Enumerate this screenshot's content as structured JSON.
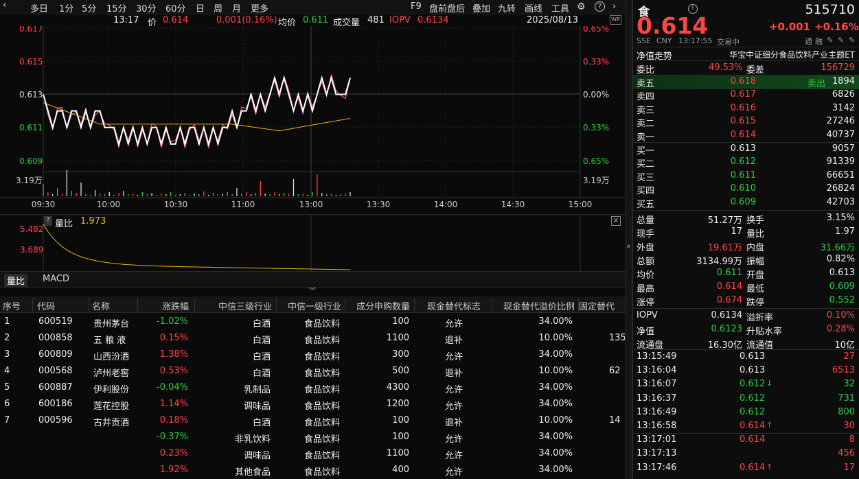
{
  "toolbar": {
    "periods": [
      "多日",
      "1分",
      "5分",
      "15分",
      "30分",
      "60分",
      "日",
      "周",
      "月",
      "更多"
    ],
    "actions": [
      "F9",
      "盘前盘后",
      "叠加",
      "九转",
      "画线",
      "工具"
    ]
  },
  "info": {
    "time": "13:17",
    "price_label": "价",
    "price": "0.614",
    "change": "0.001(0.16%)",
    "avg_label": "均价",
    "avg": "0.611",
    "vol_label": "成交量",
    "vol": "481",
    "iopv_label": "IOPV",
    "iopv": "0.6134",
    "date": "2025/08/13"
  },
  "chart_data": {
    "type": "line",
    "x_ticks": [
      "09:30",
      "10:00",
      "10:30",
      "11:00",
      "13:00",
      "13:30",
      "14:00",
      "14:30",
      "15:00"
    ],
    "y_left": [
      "0.617",
      "0.615",
      "0.613",
      "0.611",
      "0.609"
    ],
    "y_right": [
      "0.65%",
      "0.33%",
      "0.00%",
      "0.33%",
      "0.65%"
    ],
    "vol_label": "3.19万",
    "price_series": [
      0.613,
      0.612,
      0.611,
      0.612,
      0.612,
      0.611,
      0.612,
      0.612,
      0.611,
      0.612,
      0.611,
      0.612,
      0.612,
      0.611,
      0.611,
      0.611,
      0.61,
      0.611,
      0.61,
      0.611,
      0.61,
      0.611,
      0.61,
      0.611,
      0.611,
      0.61,
      0.611,
      0.61,
      0.61,
      0.611,
      0.61,
      0.611,
      0.611,
      0.61,
      0.611,
      0.61,
      0.611,
      0.61,
      0.611,
      0.611,
      0.612,
      0.611,
      0.612,
      0.612,
      0.613,
      0.612,
      0.613,
      0.612,
      0.613,
      0.614,
      0.613,
      0.614,
      0.613,
      0.612,
      0.613,
      0.612,
      0.613,
      0.612,
      0.613,
      0.614,
      0.613,
      0.614,
      0.613,
      0.613,
      0.613,
      0.614
    ],
    "avg_series_start": 0.6125,
    "avg_series_end": 0.6112,
    "sub_label": "量比",
    "sub_value": "1.973",
    "sub_y": [
      "5.482",
      "3.689"
    ]
  },
  "subtabs": [
    "量比",
    "MACD"
  ],
  "table": {
    "headers": [
      "序号",
      "代码",
      "名称",
      "涨跌幅",
      "中信三级行业",
      "中信一级行业",
      "成分申购数量",
      "现金替代标志",
      "现金替代溢价比例",
      "固定替代"
    ],
    "rows": [
      {
        "no": "1",
        "code": "600519",
        "name": "贵州茅台",
        "chg": "-1.02%",
        "ind3": "白酒",
        "ind1": "食品饮料",
        "qty": "100",
        "flag": "允许",
        "ratio": "34.00%",
        "fixed": ""
      },
      {
        "no": "2",
        "code": "000858",
        "name": "五 粮 液",
        "chg": "0.15%",
        "ind3": "白酒",
        "ind1": "食品饮料",
        "qty": "1100",
        "flag": "退补",
        "ratio": "10.00%",
        "fixed": "135"
      },
      {
        "no": "3",
        "code": "600809",
        "name": "山西汾酒",
        "chg": "1.38%",
        "ind3": "白酒",
        "ind1": "食品饮料",
        "qty": "300",
        "flag": "允许",
        "ratio": "34.00%",
        "fixed": ""
      },
      {
        "no": "4",
        "code": "000568",
        "name": "泸州老窖",
        "chg": "0.53%",
        "ind3": "白酒",
        "ind1": "食品饮料",
        "qty": "500",
        "flag": "退补",
        "ratio": "10.00%",
        "fixed": "62"
      },
      {
        "no": "5",
        "code": "600887",
        "name": "伊利股份",
        "chg": "-0.04%",
        "ind3": "乳制品",
        "ind1": "食品饮料",
        "qty": "4300",
        "flag": "允许",
        "ratio": "34.00%",
        "fixed": ""
      },
      {
        "no": "6",
        "code": "600186",
        "name": "莲花控股",
        "chg": "1.14%",
        "ind3": "调味品",
        "ind1": "食品饮料",
        "qty": "1200",
        "flag": "允许",
        "ratio": "34.00%",
        "fixed": ""
      },
      {
        "no": "7",
        "code": "000596",
        "name": "古井贡酒",
        "chg": "0.18%",
        "ind3": "白酒",
        "ind1": "食品饮料",
        "qty": "100",
        "flag": "退补",
        "ratio": "10.00%",
        "fixed": "14"
      },
      {
        "no": "",
        "code": "",
        "name": "",
        "chg": "-0.37%",
        "ind3": "非乳饮料",
        "ind1": "食品饮料",
        "qty": "100",
        "flag": "允许",
        "ratio": "34.00%",
        "fixed": ""
      },
      {
        "no": "",
        "code": "",
        "name": "",
        "chg": "0.23%",
        "ind3": "调味品",
        "ind1": "食品饮料",
        "qty": "1100",
        "flag": "允许",
        "ratio": "34.00%",
        "fixed": ""
      },
      {
        "no": "",
        "code": "",
        "name": "",
        "chg": "1.92%",
        "ind3": "其他食品",
        "ind1": "食品饮料",
        "qty": "400",
        "flag": "允许",
        "ratio": "34.00%",
        "fixed": ""
      }
    ]
  },
  "quote": {
    "name": "食",
    "code": "515710",
    "price": "0.614",
    "chg": "+0.001",
    "pct": "+0.16%",
    "exchange": "SSE",
    "currency": "CNY",
    "time": "13:17:55",
    "status": "交易中",
    "nav_trend": "净值走势",
    "fund_name": "华宝中证细分食品饮料产业主题ET",
    "weibi_label": "委比",
    "weibi": "49.53%",
    "weicha_label": "委差",
    "weicha": "156729",
    "sell_out_label": "卖出",
    "asks": [
      {
        "label": "卖五",
        "price": "0.618",
        "vol": "1894"
      },
      {
        "label": "卖四",
        "price": "0.617",
        "vol": "6826"
      },
      {
        "label": "卖三",
        "price": "0.616",
        "vol": "3142"
      },
      {
        "label": "卖二",
        "price": "0.615",
        "vol": "27246"
      },
      {
        "label": "卖一",
        "price": "0.614",
        "vol": "40737"
      }
    ],
    "bids": [
      {
        "label": "买一",
        "price": "0.613",
        "vol": "9057"
      },
      {
        "label": "买二",
        "price": "0.612",
        "vol": "91339"
      },
      {
        "label": "买三",
        "price": "0.611",
        "vol": "66651"
      },
      {
        "label": "买四",
        "price": "0.610",
        "vol": "26824"
      },
      {
        "label": "买五",
        "price": "0.609",
        "vol": "42703"
      }
    ],
    "stats": [
      {
        "l1": "总量",
        "v1": "51.27万",
        "c1": "white",
        "l2": "换手",
        "v2": "3.15%",
        "c2": "white"
      },
      {
        "l1": "现手",
        "v1": "17",
        "c1": "white",
        "l2": "量比",
        "v2": "1.97",
        "c2": "white"
      },
      {
        "l1": "外盘",
        "v1": "19.61万",
        "c1": "red",
        "l2": "内盘",
        "v2": "31.66万",
        "c2": "green"
      },
      {
        "l1": "总额",
        "v1": "3134.99万",
        "c1": "white",
        "l2": "振幅",
        "v2": "0.82%",
        "c2": "white"
      },
      {
        "l1": "均价",
        "v1": "0.611",
        "c1": "green",
        "l2": "开盘",
        "v2": "0.613",
        "c2": "white"
      },
      {
        "l1": "最高",
        "v1": "0.614",
        "c1": "red",
        "l2": "最低",
        "v2": "0.609",
        "c2": "green"
      },
      {
        "l1": "涨停",
        "v1": "0.674",
        "c1": "red",
        "l2": "跌停",
        "v2": "0.552",
        "c2": "green"
      }
    ],
    "stats2": [
      {
        "l1": "IOPV",
        "v1": "0.6134",
        "c1": "white",
        "l2": "溢折率",
        "v2": "0.10%",
        "c2": "red"
      },
      {
        "l1": "净值",
        "v1": "0.6123",
        "c1": "green",
        "l2": "升贴水率",
        "v2": "0.28%",
        "c2": "red"
      },
      {
        "l1": "流通盘",
        "v1": "16.30亿",
        "c1": "white",
        "l2": "流通值",
        "v2": "10亿",
        "c2": "white"
      }
    ],
    "ticks": [
      {
        "t": "13:15:49",
        "p": "0.613",
        "pc": "white",
        "v": "27",
        "vc": "red",
        "arrow": ""
      },
      {
        "t": "13:16:04",
        "p": "0.613",
        "pc": "white",
        "v": "6513",
        "vc": "red",
        "arrow": ""
      },
      {
        "t": "13:16:07",
        "p": "0.612",
        "pc": "green",
        "v": "32",
        "vc": "green",
        "arrow": "↓"
      },
      {
        "t": "13:16:37",
        "p": "0.612",
        "pc": "green",
        "v": "731",
        "vc": "green",
        "arrow": ""
      },
      {
        "t": "13:16:49",
        "p": "0.612",
        "pc": "green",
        "v": "800",
        "vc": "green",
        "arrow": ""
      },
      {
        "t": "13:16:58",
        "p": "0.614",
        "pc": "red",
        "v": "30",
        "vc": "red",
        "arrow": "↑"
      },
      {
        "t": "13:17:01",
        "p": "0.614",
        "pc": "red",
        "v": "8",
        "vc": "red",
        "arrow": ""
      },
      {
        "t": "13:17:13",
        "p": "",
        "pc": "white",
        "v": "456",
        "vc": "red",
        "arrow": ""
      },
      {
        "t": "13:17:46",
        "p": "0.614",
        "pc": "red",
        "v": "17",
        "vc": "red",
        "arrow": "↑"
      }
    ],
    "icon_labels": [
      "通",
      "融"
    ]
  }
}
